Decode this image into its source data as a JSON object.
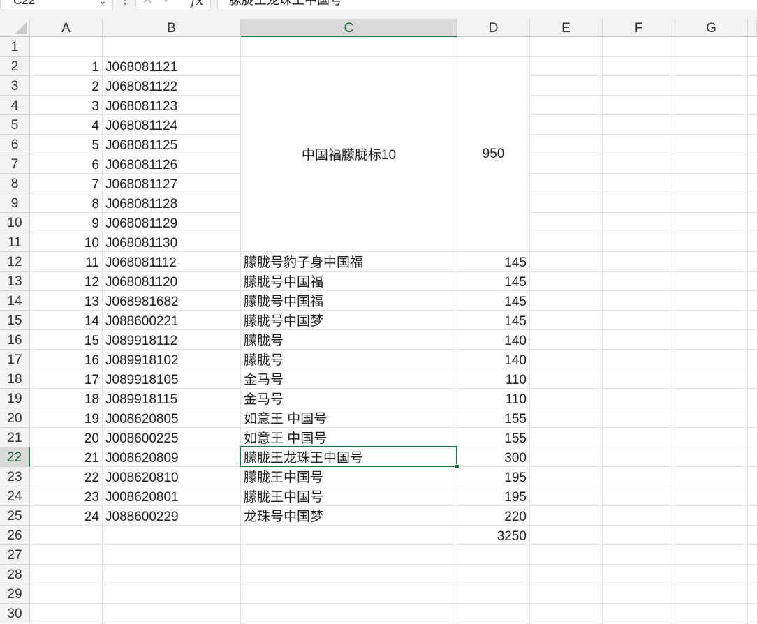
{
  "formula_bar": {
    "name_box": "C22",
    "name_box_chevron": "⌄",
    "separator": "⋮",
    "cancel_icon": "✕",
    "confirm_icon": "✓",
    "fx_label": "fx",
    "formula_value": "朦胧王龙珠王中国号"
  },
  "columns": [
    "A",
    "B",
    "C",
    "D",
    "E",
    "F",
    "G"
  ],
  "selected_column": "C",
  "rows": [
    "1",
    "2",
    "3",
    "4",
    "5",
    "6",
    "7",
    "8",
    "9",
    "10",
    "11",
    "12",
    "13",
    "14",
    "15",
    "16",
    "17",
    "18",
    "19",
    "20",
    "21",
    "22",
    "23",
    "24",
    "25",
    "26",
    "27",
    "28",
    "29",
    "30"
  ],
  "selected_row": "22",
  "merged": {
    "c_label": "中国福朦胧标10",
    "d_value": "950"
  },
  "table": [
    {
      "a": "1",
      "b": "J068081121",
      "c": "",
      "d": ""
    },
    {
      "a": "2",
      "b": "J068081122",
      "c": "",
      "d": ""
    },
    {
      "a": "3",
      "b": "J068081123",
      "c": "",
      "d": ""
    },
    {
      "a": "4",
      "b": "J068081124",
      "c": "",
      "d": ""
    },
    {
      "a": "5",
      "b": "J068081125",
      "c": "",
      "d": ""
    },
    {
      "a": "6",
      "b": "J068081126",
      "c": "",
      "d": ""
    },
    {
      "a": "7",
      "b": "J068081127",
      "c": "",
      "d": ""
    },
    {
      "a": "8",
      "b": "J068081128",
      "c": "",
      "d": ""
    },
    {
      "a": "9",
      "b": "J068081129",
      "c": "",
      "d": ""
    },
    {
      "a": "10",
      "b": "J068081130",
      "c": "",
      "d": ""
    },
    {
      "a": "11",
      "b": "J068081112",
      "c": "朦胧号豹子身中国福",
      "d": "145"
    },
    {
      "a": "12",
      "b": "J068081120",
      "c": "朦胧号中国福",
      "d": "145"
    },
    {
      "a": "13",
      "b": "J068981682",
      "c": "朦胧号中国福",
      "d": "145"
    },
    {
      "a": "14",
      "b": "J088600221",
      "c": "朦胧号中国梦",
      "d": "145"
    },
    {
      "a": "15",
      "b": "J089918112",
      "c": "朦胧号",
      "d": "140"
    },
    {
      "a": "16",
      "b": "J089918102",
      "c": "朦胧号",
      "d": "140"
    },
    {
      "a": "17",
      "b": "J089918105",
      "c": "金马号",
      "d": "110"
    },
    {
      "a": "18",
      "b": "J089918115",
      "c": "金马号",
      "d": "110"
    },
    {
      "a": "19",
      "b": "J008620805",
      "c": "如意王 中国号",
      "d": "155"
    },
    {
      "a": "20",
      "b": "J008600225",
      "c": "如意王 中国号",
      "d": "155"
    },
    {
      "a": "21",
      "b": "J008620809",
      "c": "朦胧王龙珠王中国号",
      "d": "300"
    },
    {
      "a": "22",
      "b": "J008620810",
      "c": "朦胧王中国号",
      "d": "195"
    },
    {
      "a": "23",
      "b": "J008620801",
      "c": "朦胧王中国号",
      "d": "195"
    },
    {
      "a": "24",
      "b": "J088600229",
      "c": "龙珠号中国梦",
      "d": "220"
    }
  ],
  "total": "3250"
}
